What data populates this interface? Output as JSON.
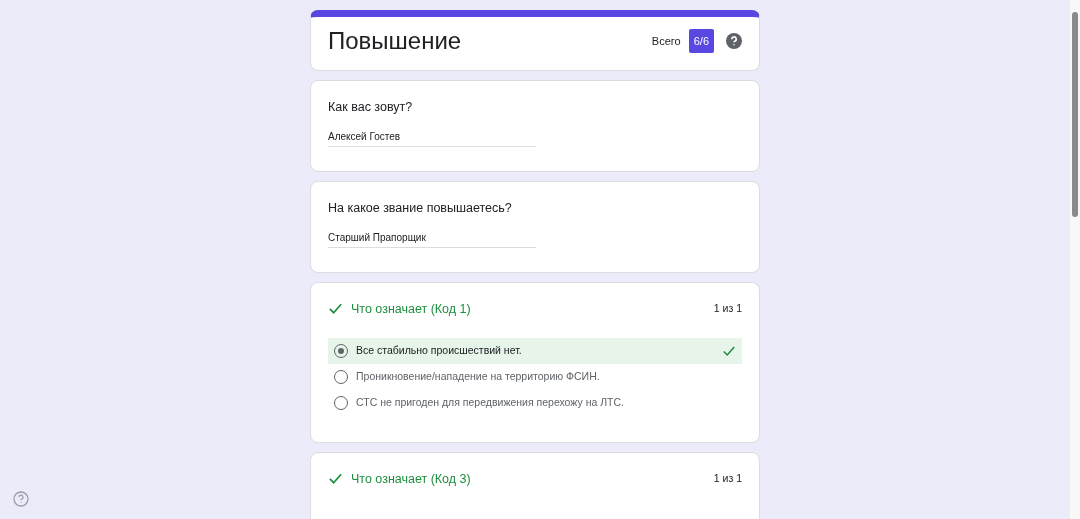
{
  "form": {
    "title": "Повышение",
    "total_label": "Всего",
    "score": "6/6"
  },
  "questions": [
    {
      "kind": "text",
      "title": "Как вас зовут?",
      "value": "Алексей Гостев"
    },
    {
      "kind": "text",
      "title": "На какое звание повышаетесь?",
      "value": "Старший Прапорщик"
    },
    {
      "kind": "choice",
      "title": "Что означает (Код 1)",
      "correct": true,
      "score": "1 из 1",
      "options": [
        {
          "label": "Все стабильно происшествий нет.",
          "selected": true,
          "correct": true
        },
        {
          "label": "Проникновение/нападение на территорию ФСИН.",
          "selected": false,
          "correct": false
        },
        {
          "label": "СТС не пригоден для передвижения перехожу на ЛТС.",
          "selected": false,
          "correct": false
        }
      ]
    },
    {
      "kind": "choice",
      "title": "Что означает (Код 3)",
      "correct": true,
      "score": "1 из 1"
    }
  ]
}
